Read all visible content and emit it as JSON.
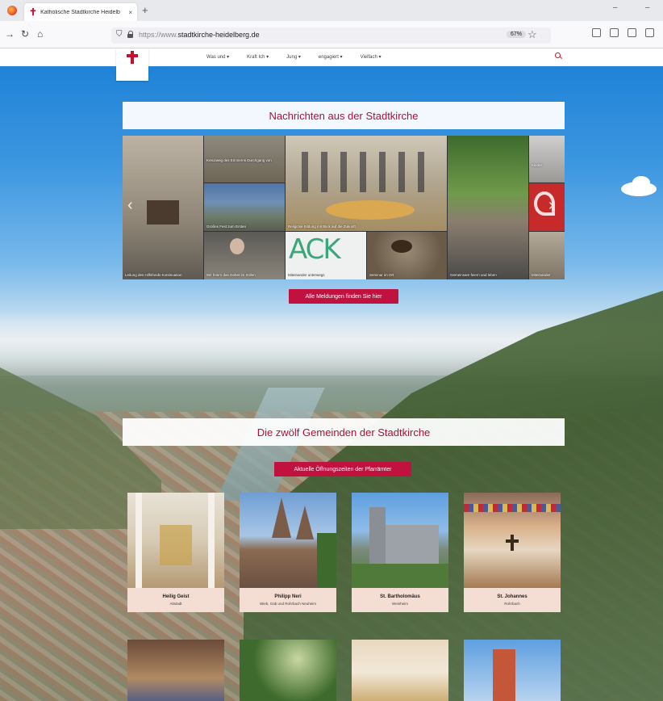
{
  "browser": {
    "tab_title": "Katholische Stadtkirche Heidelb",
    "tab_close": "×",
    "new_tab": "+",
    "url_prefix": "https://www.",
    "url_domain": "stadtkirche-heidelberg.de",
    "zoom": "67%",
    "icons": [
      "back-arrow-icon",
      "forward-arrow-icon",
      "reload-icon",
      "home-icon",
      "shield-icon",
      "lock-icon",
      "star-icon"
    ]
  },
  "site": {
    "nav": [
      "Was und ▾",
      "Kraft Ich ▾",
      "Jung ▾",
      "engagiert ▾",
      "Vielfach ▾"
    ]
  },
  "news": {
    "title": "Nachrichten aus der Stadtkirche",
    "tiles": [
      {
        "caption": "Leitung des Hilfsfonds Kontinuation"
      },
      {
        "caption": "Kreuzweg des Erinnerns Durchgang von"
      },
      {
        "caption": "Großes Fest zum Ersten"
      },
      {
        "caption": "Wir feiern das Gebet im Stillen"
      },
      {
        "caption": "Religiöse Bildung mit Blick auf die Zukunft"
      },
      {
        "caption": "Miteinander unterwegs"
      },
      {
        "caption": "Seminar im Ort"
      },
      {
        "caption": "Gemeinsam feiern und leben"
      },
      {
        "caption": "Kinder"
      },
      {
        "caption": "Miteinander"
      }
    ],
    "ack_text": "ACK",
    "cta": "Alle Meldungen finden Sie hier"
  },
  "parishes": {
    "title": "Die zwölf Gemeinden der Stadtkirche",
    "cta": "Aktuelle Öffnungszeiten der Pfarrämter",
    "cards": [
      {
        "name": "Heilig Geist",
        "sub": "Altstadt"
      },
      {
        "name": "Philipp Neri",
        "sub": "Wieb, Gab und Rohrbach Neuheim"
      },
      {
        "name": "St. Bartholomäus",
        "sub": "Weinheim"
      },
      {
        "name": "St. Johannes",
        "sub": "Rohrbach"
      }
    ]
  },
  "colors": {
    "accent": "#c0113f",
    "banner_text": "#b0103a",
    "card_bg": "#f4ddd2"
  }
}
